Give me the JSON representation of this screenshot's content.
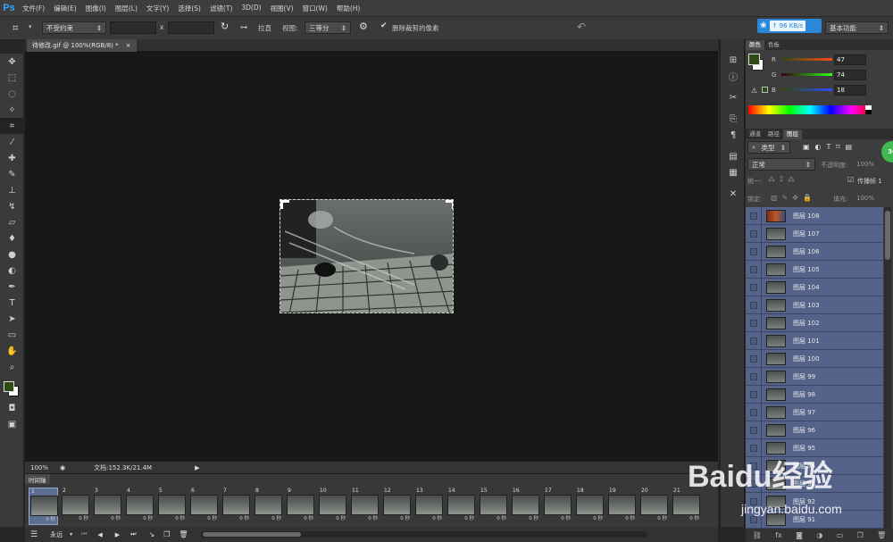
{
  "app": {
    "logo": "Ps"
  },
  "menu": [
    "文件(F)",
    "编辑(E)",
    "图像(I)",
    "图层(L)",
    "文字(Y)",
    "选择(S)",
    "滤镜(T)",
    "3D(D)",
    "视图(V)",
    "窗口(W)",
    "帮助(H)"
  ],
  "options": {
    "ratio_select": "不受约束",
    "x_sep": "x",
    "straighten_label": "拉直",
    "view_label": "视图:",
    "view_select": "三等分",
    "delete_cropped_label": "删除裁剪的像素",
    "net_speed": "96 KB/s",
    "workspace_select": "基本功能"
  },
  "document": {
    "tab_title": "待修改.gif @ 100%(RGB/8) *",
    "zoom": "100%",
    "doc_info": "文档:152.3K/21.4M"
  },
  "timeline": {
    "tab_label": "时间轴",
    "loop_select": "永远",
    "frames": [
      "1",
      "2",
      "3",
      "4",
      "5",
      "6",
      "7",
      "8",
      "9",
      "10",
      "11",
      "12",
      "13",
      "14",
      "15",
      "16",
      "17",
      "18",
      "19",
      "20",
      "21"
    ],
    "frame_delay": "0 秒"
  },
  "color_panel": {
    "tabs": [
      "颜色",
      "色板"
    ],
    "r_label": "R",
    "r_value": "47",
    "g_label": "G",
    "g_value": "74",
    "b_label": "B",
    "b_value": "18",
    "fg_color": "#2f4a12",
    "bg_color": "#ffffff"
  },
  "layers_panel": {
    "tabs": [
      "通道",
      "路径",
      "图层"
    ],
    "filter_select": "类型",
    "blend_mode": "正常",
    "opacity_label": "不透明度:",
    "opacity_value": "100%",
    "unify_label": "统一:",
    "propagate_label": "传播帧 1",
    "lock_label": "锁定:",
    "fill_label": "填充:",
    "fill_value": "100%",
    "layers": [
      "图层 108",
      "图层 107",
      "图层 106",
      "图层 105",
      "图层 104",
      "图层 103",
      "图层 102",
      "图层 101",
      "图层 100",
      "图层 99",
      "图层 98",
      "图层 97",
      "图层 96",
      "图层 95",
      "图层 94",
      "图层 93",
      "图层 92",
      "图层 91"
    ]
  },
  "badge": {
    "text": "36"
  },
  "watermark": {
    "brand": "Baidu经验",
    "url": "jingyan.baidu.com"
  }
}
